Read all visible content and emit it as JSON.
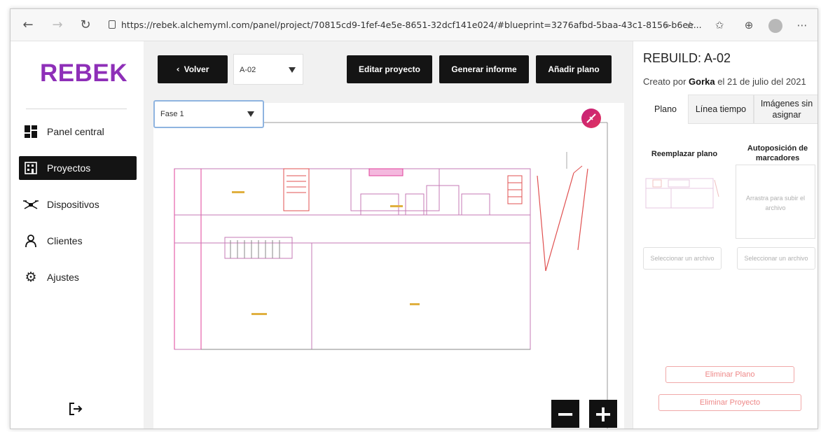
{
  "browser": {
    "url": "https://rebek.alchemyml.com/panel/project/70815cd9-1fef-4e5e-8651-32dcf141e024/#blueprint=3276afbd-5baa-43c1-8156-b6ee..."
  },
  "sidebar": {
    "logo": "REBEK",
    "items": [
      {
        "label": "Panel central",
        "icon": "dashboard-icon"
      },
      {
        "label": "Proyectos",
        "icon": "building-icon",
        "active": true
      },
      {
        "label": "Dispositivos",
        "icon": "drone-icon"
      },
      {
        "label": "Clientes",
        "icon": "user-icon"
      },
      {
        "label": "Ajustes",
        "icon": "gear-icon"
      }
    ]
  },
  "main": {
    "back_label": "Volver",
    "plan_select": "A-02",
    "edit_project": "Editar proyecto",
    "generate_report": "Generar informe",
    "add_plan": "Añadir plano",
    "phase_select": "Fase 1"
  },
  "panel": {
    "title": "REBUILD: A-02",
    "created_prefix": "Creato por",
    "author": "Gorka",
    "created_suffix": "el 21 de julio del 2021",
    "tabs": [
      "Plano",
      "Línea tiempo",
      "Imágenes sin asignar"
    ],
    "replace_plan": "Reemplazar plano",
    "auto_position": "Autoposición de marcadores",
    "dropzone_text": "Arrastra para subir el archivo",
    "select_file_1": "Seleccionar un archivo",
    "select_file_2": "Seleccionar un archivo",
    "delete_plan": "Eliminar Plano",
    "delete_project": "Eliminar Proyecto"
  },
  "colors": {
    "brand": "#8e2fb8",
    "dark_button": "#141414",
    "danger": "#f0a8a8",
    "plan_magenta": "#e0409a",
    "plan_red": "#e05050"
  }
}
